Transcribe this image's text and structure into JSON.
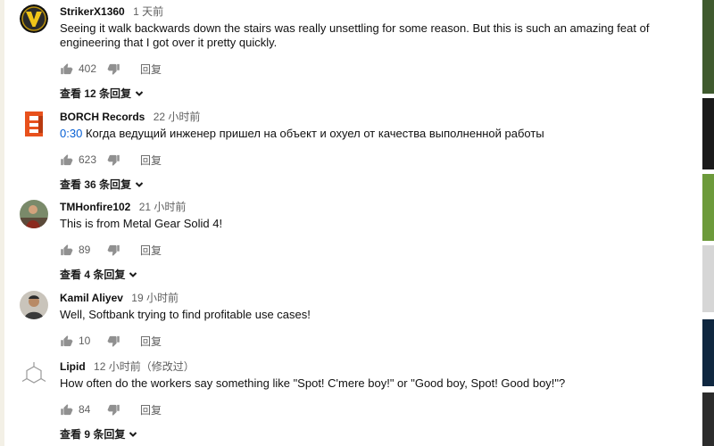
{
  "comments": [
    {
      "author": "StrikerX1360",
      "time": "1 天前",
      "text": "Seeing it walk backwards down the stairs was really unsettling for some reason. But this is such an amazing feat of engineering that I got over it pretty quickly.",
      "likes": "402",
      "reply_label": "回复",
      "view_replies": "查看 12 条回复"
    },
    {
      "author": "BORCH Records",
      "time": "22 小时前",
      "timestamp": "0:30",
      "text": "Когда ведущий инженер пришел на объект и охуел от качества выполненной работы",
      "likes": "623",
      "reply_label": "回复",
      "view_replies": "查看 36 条回复"
    },
    {
      "author": "TMHonfire102",
      "time": "21 小时前",
      "text": "This is from Metal Gear Solid 4!",
      "likes": "89",
      "reply_label": "回复",
      "view_replies": "查看 4 条回复"
    },
    {
      "author": "Kamil Aliyev",
      "time": "19 小时前",
      "text": "Well, Softbank trying to find profitable use cases!",
      "likes": "10",
      "reply_label": "回复"
    },
    {
      "author": "Lipid",
      "time": "12 小时前（修改过）",
      "text": "How often do the workers say something like \"Spot! C'mere boy!\" or \"Good boy, Spot! Good boy!\"?",
      "likes": "84",
      "reply_label": "回复",
      "view_replies": "查看 9 条回复"
    }
  ],
  "colors": {
    "link": "#065fd4",
    "meta": "#606060",
    "icon": "#909090"
  },
  "icons": {
    "like": "thumbs-up-icon",
    "dislike": "thumbs-down-icon",
    "expand": "chevron-down-icon"
  }
}
